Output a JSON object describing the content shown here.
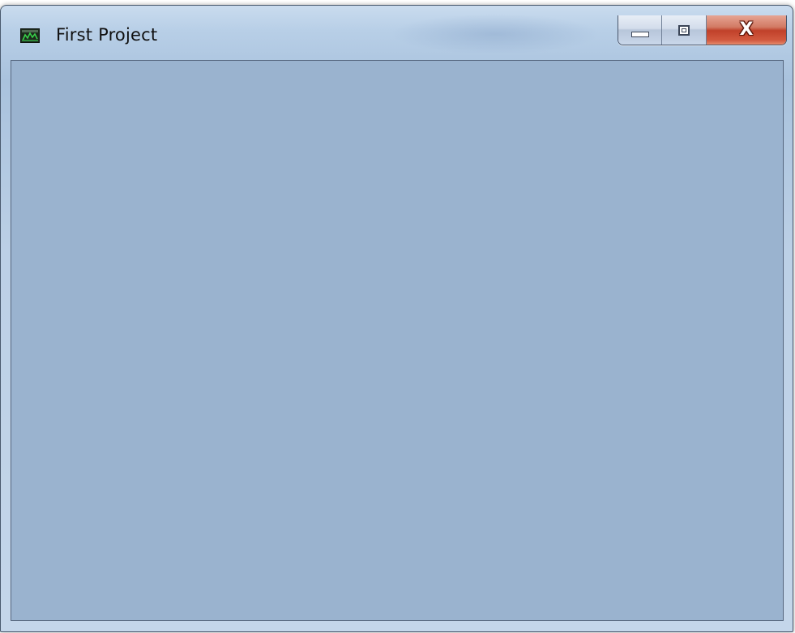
{
  "window": {
    "title": "First Project",
    "icon": "app-window-icon",
    "controls": {
      "minimize_icon": "minimize-icon",
      "maximize_icon": "maximize-icon",
      "close_icon": "close-icon",
      "close_glyph": "X"
    }
  },
  "colors": {
    "client_background": "#9ab3cf",
    "close_button": "#c84a33",
    "title_text": "#111111"
  }
}
